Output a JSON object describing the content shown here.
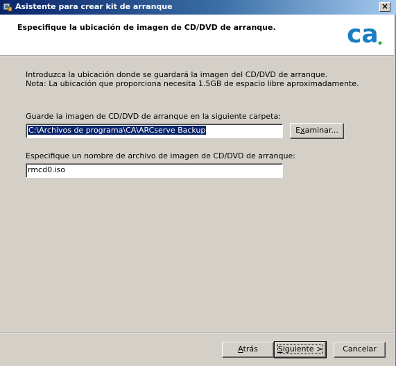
{
  "window": {
    "title": "Asistente para crear kit de arranque",
    "close_label": "×"
  },
  "header": {
    "title": "Especifique la ubicación de imagen de CD/DVD de arranque.",
    "logo_text": "ca",
    "logo_color": "#1a7fc1",
    "logo_dot_color": "#2aa544"
  },
  "intro": {
    "line1": "Introduzca la ubicación donde se guardará la imagen del CD/DVD de arranque.",
    "line2": "Nota: La ubicación que proporciona necesita 1.5GB de espacio libre aproximadamente."
  },
  "folder": {
    "label": "Guarde la imagen de CD/DVD de arranque en la siguiente carpeta:",
    "value": "C:\\Archivos de programa\\CA\\ARCserve Backup",
    "browse_label_pre": "E",
    "browse_label_mnemonic": "x",
    "browse_label_post": "aminar..."
  },
  "filename": {
    "label": "Especifique un nombre de archivo de imagen de CD/DVD de arranque:",
    "value": "rmcd0.iso"
  },
  "buttons": {
    "back_mnemonic": "A",
    "back_rest": "trás",
    "next_mnemonic": "S",
    "next_rest": "iguiente >",
    "cancel": "Cancelar"
  }
}
